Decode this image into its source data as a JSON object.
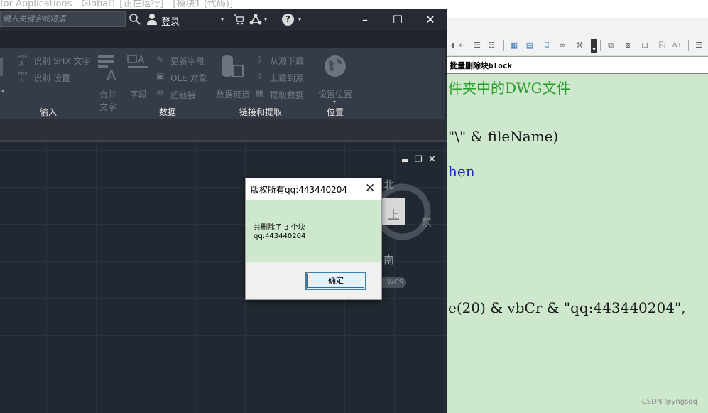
{
  "background": {
    "vba_title": "for Applications - Global1 [正在运行] - [模块1 (代码)]"
  },
  "vba_editor": {
    "procedure_label": "批量删除块block",
    "code_lines": [
      {
        "text": "件夹中的DWG文件",
        "color": "#2a9d2a"
      },
      {
        "text": "\"\\\" & fileName)",
        "color": "#1a1a1a"
      },
      {
        "text": "hen",
        "color": "#1f2bb8"
      },
      {
        "text": "e(20) & vbCr & \"qq:443440204\",",
        "color": "#1a1a1a"
      }
    ],
    "watermark": "CSDN @yngsqq"
  },
  "acad": {
    "search_placeholder": "键入关键字或短语",
    "login_label": "登录",
    "dropdown_glyph": "▾",
    "help_glyph": "?",
    "window_controls": {
      "minimize": "–",
      "maximize": "☐",
      "close": "✕"
    },
    "ribbon": {
      "panels": [
        {
          "title": "输入",
          "items": [
            "识别 SHX 文字",
            "识别 设置",
            "合并",
            "文字"
          ]
        },
        {
          "title": "数据",
          "items": [
            "字段",
            "更新字段",
            "OLE 对象",
            "超链接"
          ]
        },
        {
          "title": "链接和提取",
          "items": [
            "数据链接",
            "从源下载",
            "上载到源",
            "提取数据"
          ]
        },
        {
          "title": "位置",
          "items": [
            "设置位置"
          ]
        }
      ],
      "pdf_tag": "PDF"
    },
    "viewport_controls": {
      "minimize": "▬",
      "restore": "❐",
      "close": "✕"
    },
    "viewcube": {
      "north": "北",
      "east": "东",
      "south": "南",
      "top": "上",
      "wcs": "WCS"
    }
  },
  "dialog": {
    "title": "版权所有qq:443440204",
    "close_glyph": "✕",
    "message_line1": "共删除了 3 个块",
    "message_line2": "qq:443440204",
    "ok_label": "确定"
  }
}
